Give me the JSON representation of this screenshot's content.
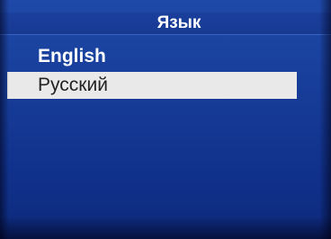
{
  "screen": {
    "title": "Язык"
  },
  "menu": {
    "items": [
      {
        "label": "English",
        "selected": false
      },
      {
        "label": "Русский",
        "selected": true
      }
    ]
  },
  "colors": {
    "background": "#163c98",
    "title_text": "#ffffff",
    "highlight_background": "#e9e9e9",
    "highlight_text": "#222222"
  }
}
